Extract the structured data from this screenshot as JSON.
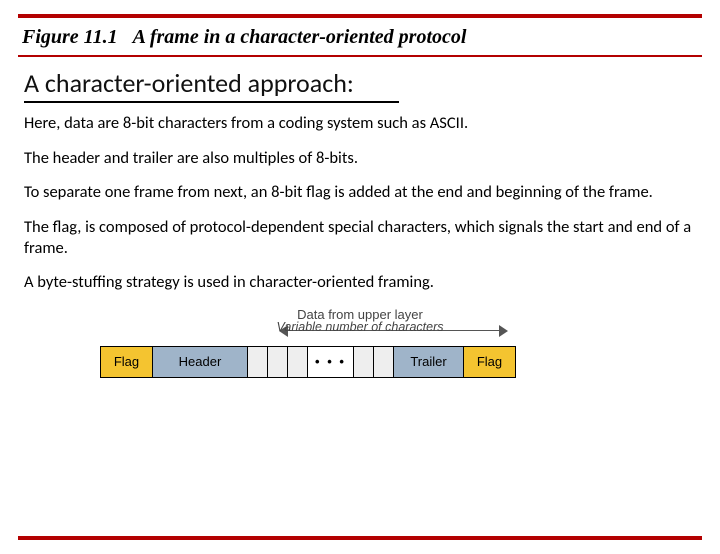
{
  "figure": {
    "number": "Figure 11.1",
    "caption": "A frame in a character-oriented protocol"
  },
  "subtitle": "A character-oriented approach:",
  "paragraphs": {
    "p1": "Here, data are 8-bit characters from a coding system such as ASCII.",
    "p2": "The header and trailer are also multiples of 8-bits.",
    "p3": "To separate one frame from next, an 8-bit flag is added at the end and beginning of the frame.",
    "p4": "The flag, is composed of protocol-dependent special characters, which signals the start and end of a frame.",
    "p5": "A byte-stuffing strategy is used in character-oriented framing."
  },
  "diagram": {
    "upper_label": "Data from upper layer",
    "span_label": "Variable number of characters",
    "cells": {
      "flag1": "Flag",
      "header": "Header",
      "dots": "• • •",
      "trailer": "Trailer",
      "flag2": "Flag"
    }
  }
}
